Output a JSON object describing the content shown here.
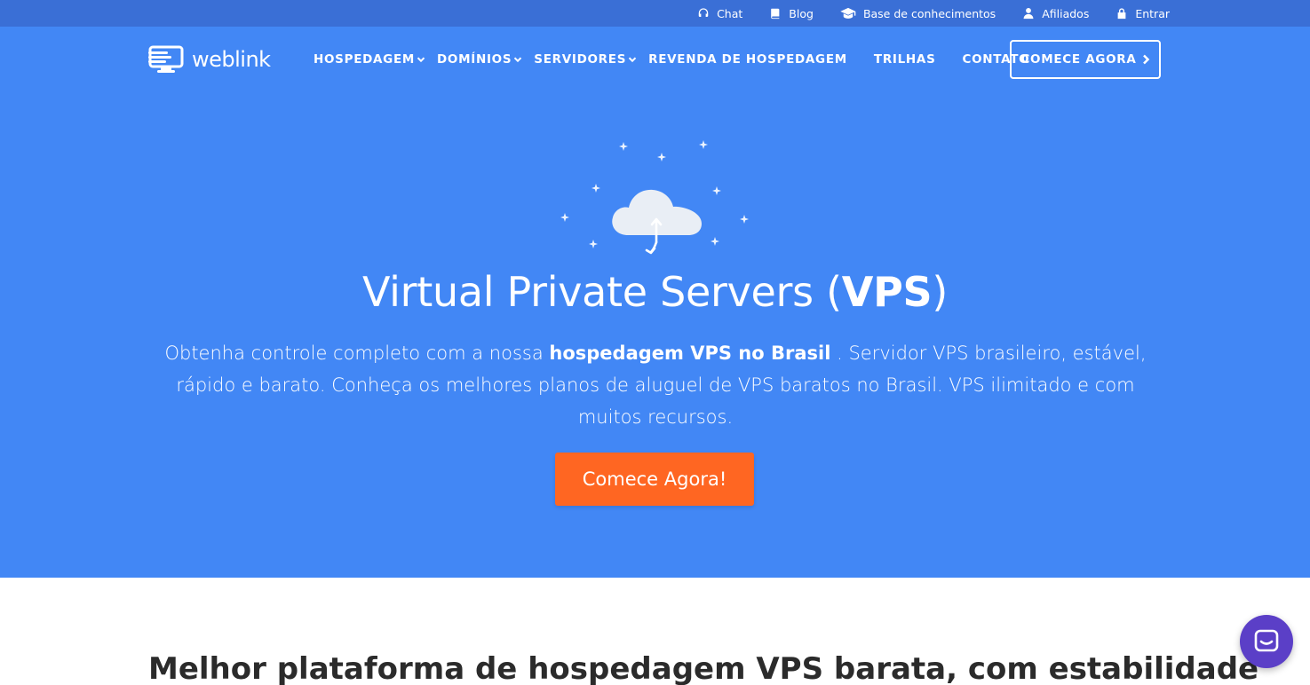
{
  "topbar": {
    "links": [
      {
        "label": "Chat",
        "icon": "headset-icon"
      },
      {
        "label": "Blog",
        "icon": "book-icon"
      },
      {
        "label": "Base de conhecimentos",
        "icon": "graduation-cap-icon"
      },
      {
        "label": "Afiliados",
        "icon": "user-icon"
      },
      {
        "label": "Entrar",
        "icon": "lock-icon"
      }
    ]
  },
  "brand": {
    "name": "weblink"
  },
  "nav": {
    "items": [
      {
        "label": "HOSPEDAGEM",
        "has_dropdown": true
      },
      {
        "label": "DOMÍNIOS",
        "has_dropdown": true
      },
      {
        "label": "SERVIDORES",
        "has_dropdown": true
      },
      {
        "label": "REVENDA DE HOSPEDAGEM",
        "has_dropdown": false
      },
      {
        "label": "TRILHAS",
        "has_dropdown": false
      },
      {
        "label": "CONTATO",
        "has_dropdown": false
      }
    ],
    "cta_label": "COMECE AGORA"
  },
  "hero": {
    "title_prefix": "Virtual Private Servers (",
    "title_bold": "VPS",
    "title_suffix": ")",
    "subtitle_prefix": "Obtenha controle completo com a nossa ",
    "subtitle_bold": "hospedagem VPS no Brasil",
    "subtitle_suffix": " . Servidor VPS brasileiro, estável, rápido e barato. Conheça os melhores planos de aluguel de VPS baratos no Brasil. VPS ilimitado e com muitos recursos.",
    "button_label": "Comece Agora!"
  },
  "section": {
    "title_bold": "Melhor plataforma de hospedagem VPS barata,",
    "title_rest": " com estabilidade"
  },
  "colors": {
    "topbar": "#3a6fd6",
    "hero": "#4287f5",
    "cta": "#ff6622",
    "chat": "#5b3fc7"
  }
}
